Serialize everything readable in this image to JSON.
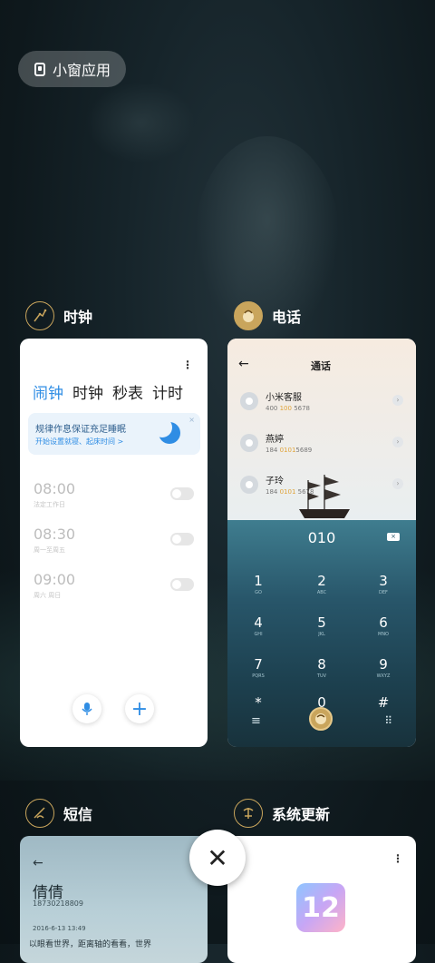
{
  "pill": {
    "label": "小窗应用"
  },
  "clock_app": {
    "name": "时钟",
    "tabs": [
      "闹钟",
      "时钟",
      "秒表",
      "计时"
    ],
    "banner": {
      "title": "规律作息保证充足睡眠",
      "subtitle": "开始设置就寝、起床时间 >",
      "close": "×"
    },
    "alarms": [
      {
        "time": "08:00",
        "days": "法定工作日"
      },
      {
        "time": "08:30",
        "days": "周一至周五"
      },
      {
        "time": "09:00",
        "days": "周六 周日"
      }
    ],
    "menu": "⋮",
    "add": "+"
  },
  "phone_app": {
    "name": "电话",
    "title": "通话",
    "back": "←",
    "contacts": [
      {
        "name": "小米客服",
        "num_pre": "400 ",
        "num_hl": "100",
        "num_post": " 5678"
      },
      {
        "name": "燕婷",
        "num_pre": "184 ",
        "num_hl": "0101",
        "num_post": "5689"
      },
      {
        "name": "子玲",
        "num_pre": "184 ",
        "num_hl": "0101",
        "num_post": " 5678"
      }
    ],
    "dial_input": "010",
    "keys": [
      {
        "d": "1",
        "l": "GO"
      },
      {
        "d": "2",
        "l": "ABC"
      },
      {
        "d": "3",
        "l": "DEF"
      },
      {
        "d": "4",
        "l": "GHI"
      },
      {
        "d": "5",
        "l": "JKL"
      },
      {
        "d": "6",
        "l": "MNO"
      },
      {
        "d": "7",
        "l": "PQRS"
      },
      {
        "d": "8",
        "l": "TUV"
      },
      {
        "d": "9",
        "l": "WXYZ"
      },
      {
        "d": "*",
        "l": ""
      },
      {
        "d": "0",
        "l": "+"
      },
      {
        "d": "#",
        "l": ""
      }
    ],
    "menu_glyph": "≡",
    "grid_glyph": "⠿"
  },
  "sms_app": {
    "name": "短信",
    "contact": "倩倩",
    "number": "18730218809",
    "date": "2016-6-13 13:49",
    "snippet": "以眼看世界，距离轴的看看，世界",
    "back": "←"
  },
  "update_app": {
    "name": "系统更新",
    "logo_text": "12",
    "menu": "⋮"
  },
  "close_glyph": "✕",
  "colors": {
    "accent": "#2f8de4",
    "gold": "#c9a55c",
    "highlight": "#e0a43a"
  }
}
